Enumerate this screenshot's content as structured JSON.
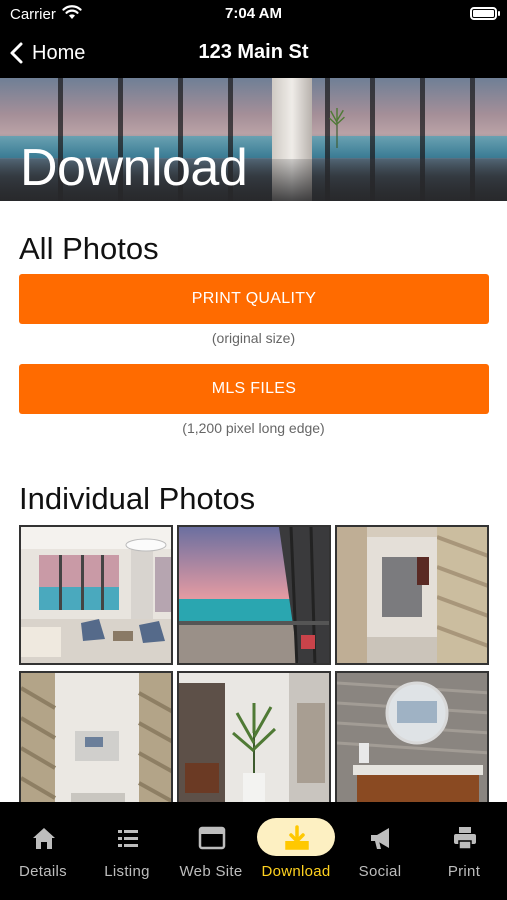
{
  "status": {
    "carrier": "Carrier",
    "time": "7:04 AM",
    "battery_level": 1.0
  },
  "nav": {
    "back_label": "Home",
    "title": "123 Main St"
  },
  "hero": {
    "title": "Download"
  },
  "all_photos": {
    "title": "All Photos",
    "print_button": "PRINT QUALITY",
    "print_caption": "(original size)",
    "mls_button": "MLS FILES",
    "mls_caption": "(1,200 pixel long edge)"
  },
  "individual": {
    "title": "Individual Photos"
  },
  "photos": [
    {
      "icon": "living-room-photo"
    },
    {
      "icon": "balcony-ocean-photo"
    },
    {
      "icon": "hallway-photo"
    },
    {
      "icon": "bathroom-entry-photo"
    },
    {
      "icon": "bathroom-plant-photo"
    },
    {
      "icon": "vanity-mirror-photo"
    }
  ],
  "tabs": [
    {
      "label": "Details",
      "icon": "home-icon"
    },
    {
      "label": "Listing",
      "icon": "list-icon"
    },
    {
      "label": "Web Site",
      "icon": "browser-window-icon"
    },
    {
      "label": "Download",
      "icon": "download-icon",
      "active": true
    },
    {
      "label": "Social",
      "icon": "megaphone-icon"
    },
    {
      "label": "Print",
      "icon": "printer-icon"
    }
  ],
  "colors": {
    "accent": "#ff6b00",
    "active_tab": "#ffd21f",
    "active_pill": "#fdf0c2",
    "tab_inactive": "#bdbdbd"
  }
}
